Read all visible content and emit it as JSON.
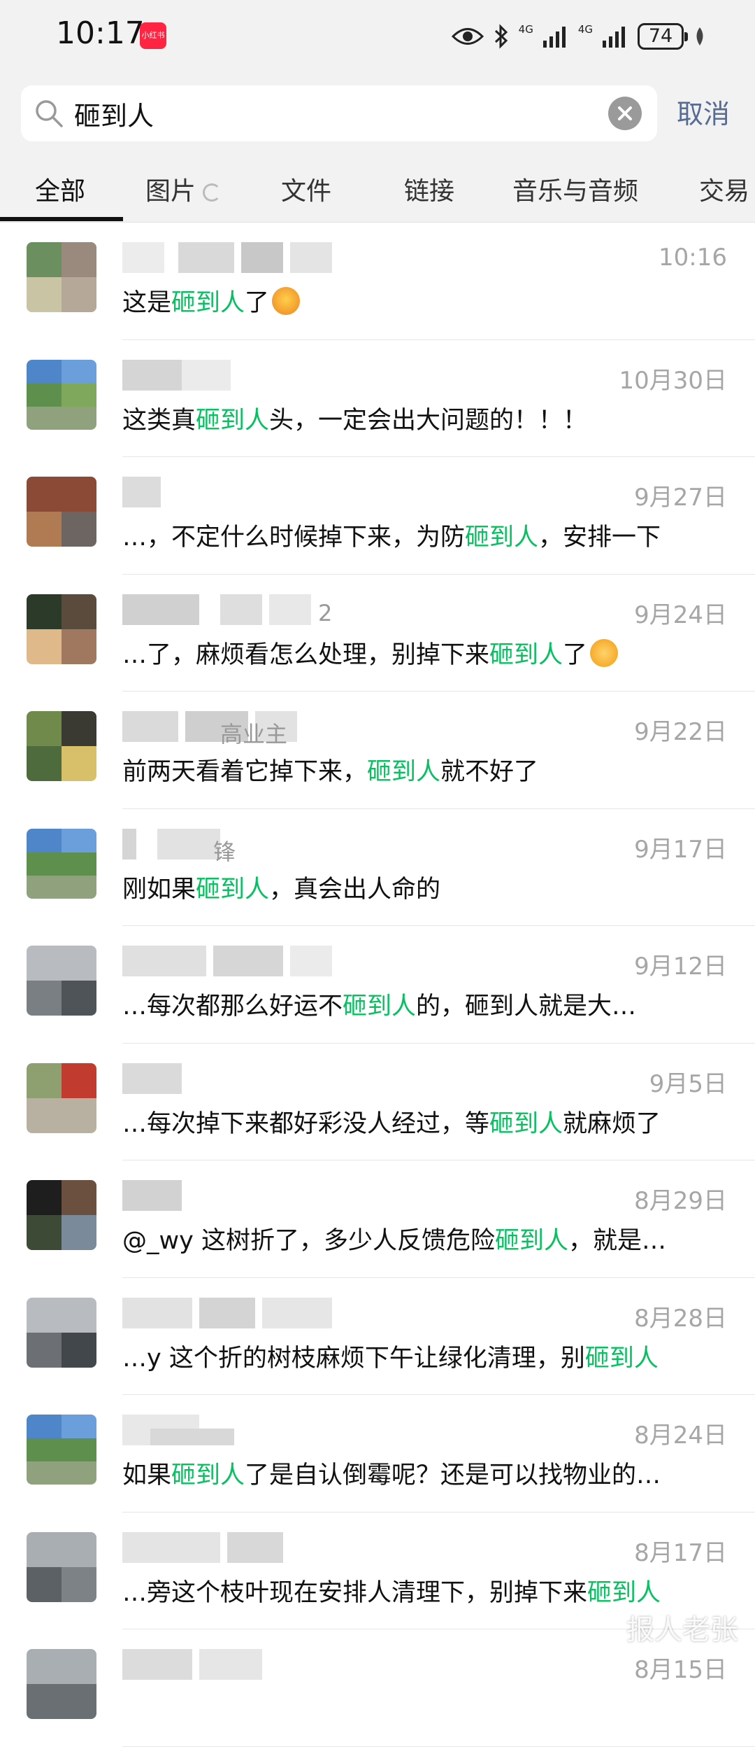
{
  "status_bar": {
    "time": "10:17",
    "app_badge": "小红书",
    "net1": "4G",
    "net2": "4G",
    "battery": "74"
  },
  "search": {
    "query": "砸到人",
    "cancel_label": "取消"
  },
  "tabs": [
    "全部",
    "图片",
    "文件",
    "链接",
    "音乐与音频",
    "交易"
  ],
  "highlight_color": "#07c160",
  "results": [
    {
      "date": "10:16",
      "name_visible": "",
      "pre": "这是",
      "hl": "砸到人",
      "post": "了",
      "emoji": "angry-face-emoji"
    },
    {
      "date": "10月30日",
      "name_visible": "",
      "pre": "这类真",
      "hl": "砸到人",
      "post": "头，一定会出大问题的！！！"
    },
    {
      "date": "9月27日",
      "name_visible": "",
      "pre": "…，不定什么时候掉下来，为防",
      "hl": "砸到人",
      "post": "，安排一下"
    },
    {
      "date": "9月24日",
      "name_visible": "2",
      "pre": "…了，麻烦看怎么处理，别掉下来",
      "hl": "砸到人",
      "post": "了",
      "emoji": "handshake-emoji"
    },
    {
      "date": "9月22日",
      "name_visible": "高业主",
      "pre": "前两天看着它掉下来，",
      "hl": "砸到人",
      "post": "就不好了"
    },
    {
      "date": "9月17日",
      "name_visible": "锋",
      "pre": "刚如果",
      "hl": "砸到人",
      "post": "，真会出人命的"
    },
    {
      "date": "9月12日",
      "name_visible": "",
      "pre": "…每次都那么好运不",
      "hl": "砸到人",
      "post": "的，砸到人就是大…"
    },
    {
      "date": "9月5日",
      "name_visible": "",
      "pre": "…每次掉下来都好彩没人经过，等",
      "hl": "砸到人",
      "post": "就麻烦了"
    },
    {
      "date": "8月29日",
      "name_visible": "",
      "pre": "@_wy 这树折了，多少人反馈危险",
      "hl": "砸到人",
      "post": "，就是…"
    },
    {
      "date": "8月28日",
      "name_visible": "",
      "pre": "…y 这个折的树枝麻烦下午让绿化清理，别",
      "hl": "砸到人",
      "post": ""
    },
    {
      "date": "8月24日",
      "name_visible": "",
      "pre": "如果",
      "hl": "砸到人",
      "post": "了是自认倒霉呢？还是可以找物业的…"
    },
    {
      "date": "8月17日",
      "name_visible": "",
      "pre": "…旁这个枝叶现在安排人清理下，别掉下来",
      "hl": "砸到人",
      "post": ""
    },
    {
      "date": "8月15日",
      "name_visible": "",
      "pre": "",
      "hl": "",
      "post": ""
    }
  ],
  "watermark": "报人老张"
}
